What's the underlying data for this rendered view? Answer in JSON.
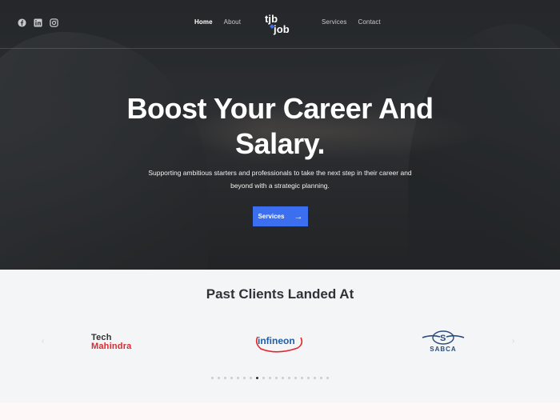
{
  "nav": {
    "links_left": [
      {
        "label": "Home",
        "active": true
      },
      {
        "label": "About",
        "active": false
      }
    ],
    "links_right": [
      {
        "label": "Services",
        "active": false
      },
      {
        "label": "Contact",
        "active": false
      }
    ],
    "logo_text": "tjb job",
    "social_icons": [
      "facebook-icon",
      "linkedin-icon",
      "instagram-icon"
    ]
  },
  "hero": {
    "title_line1": "Boost Your Career And",
    "title_line2": "Salary.",
    "subtitle_line1": "Supporting ambitious starters and professionals to take the next step in their career and",
    "subtitle_line2": "beyond with a strategic planning.",
    "cta_label": "Services",
    "cta_arrow": "→"
  },
  "clients": {
    "title": "Past Clients Landed At",
    "logos": [
      {
        "name": "Tech Mahindra",
        "line1": "Tech",
        "line2": "Mahindra"
      },
      {
        "name": "Infineon",
        "text": "infineon"
      },
      {
        "name": "SABCA",
        "text": "SABCA"
      }
    ],
    "prev_arrow": "‹",
    "next_arrow": "›",
    "dot_count": 19,
    "active_dot": 7
  },
  "colors": {
    "accent": "#3c6ff0",
    "title_dark": "#2f3338",
    "clients_bg": "#f3f5f6",
    "tech_red": "#e3262e",
    "infineon_blue": "#1f5fa6",
    "infineon_red": "#e3262e",
    "sabca_blue": "#2a4c7a"
  }
}
